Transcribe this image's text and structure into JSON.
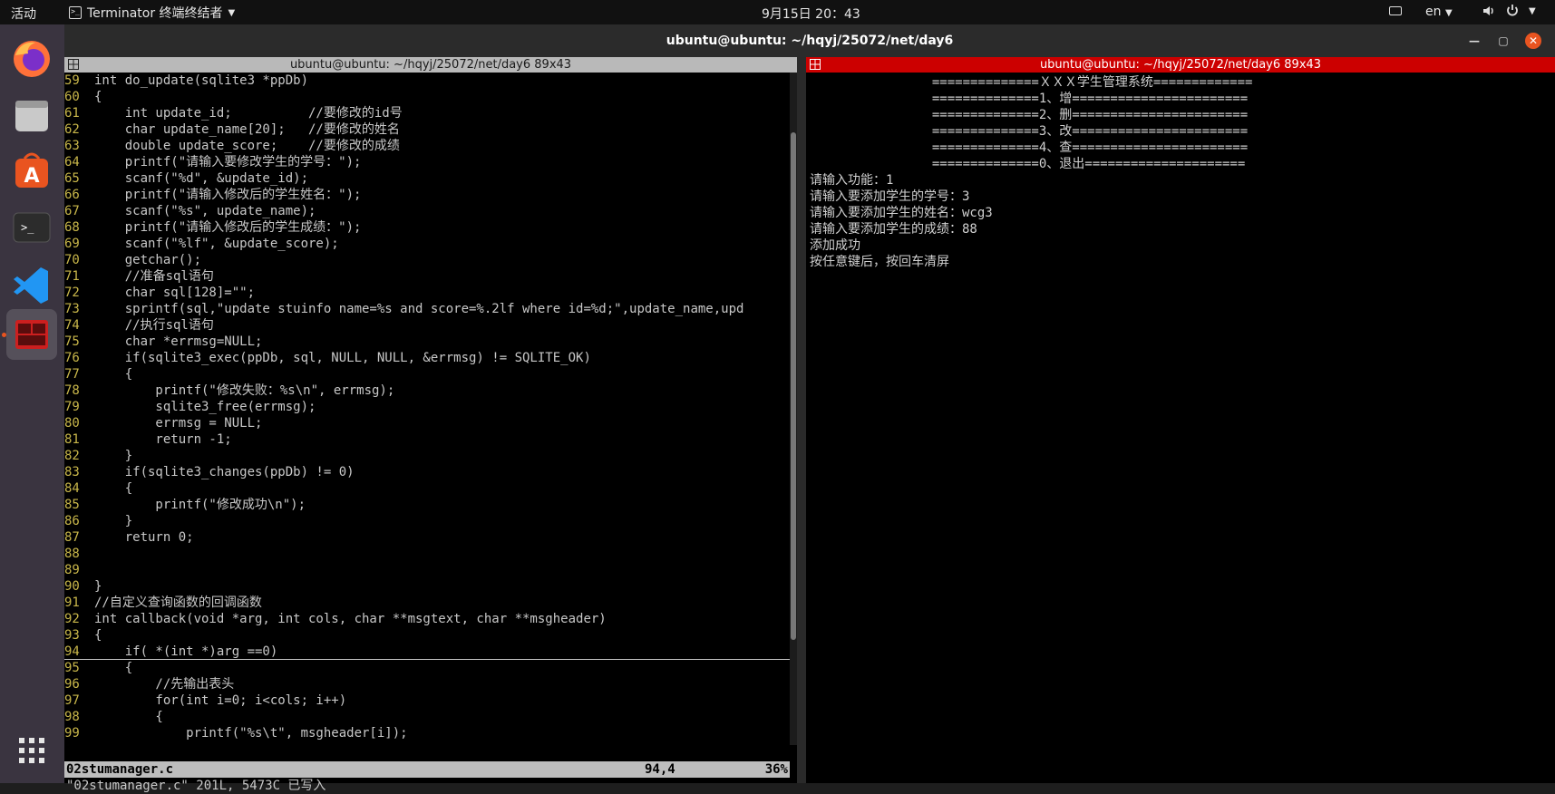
{
  "topbar": {
    "activities": "活动",
    "app_name": "Terminator 终端终结者",
    "clock": "9月15日  20：43",
    "lang": "en"
  },
  "window": {
    "title": "ubuntu@ubuntu: ~/hqyj/25072/net/day6"
  },
  "left_pane": {
    "title": "ubuntu@ubuntu: ~/hqyj/25072/net/day6 89x43",
    "lines": [
      {
        "n": "59",
        "t": "int do_update(sqlite3 *ppDb)"
      },
      {
        "n": "60",
        "t": "{"
      },
      {
        "n": "61",
        "t": "    int update_id;          //要修改的id号"
      },
      {
        "n": "62",
        "t": "    char update_name[20];   //要修改的姓名"
      },
      {
        "n": "63",
        "t": "    double update_score;    //要修改的成绩"
      },
      {
        "n": "64",
        "t": "    printf(\"请输入要修改学生的学号：\");"
      },
      {
        "n": "65",
        "t": "    scanf(\"%d\", &update_id);"
      },
      {
        "n": "66",
        "t": "    printf(\"请输入修改后的学生姓名：\");"
      },
      {
        "n": "67",
        "t": "    scanf(\"%s\", update_name);"
      },
      {
        "n": "68",
        "t": "    printf(\"请输入修改后的学生成绩：\");"
      },
      {
        "n": "69",
        "t": "    scanf(\"%lf\", &update_score);"
      },
      {
        "n": "70",
        "t": "    getchar();"
      },
      {
        "n": "71",
        "t": "    //准备sql语句"
      },
      {
        "n": "72",
        "t": "    char sql[128]=\"\";"
      },
      {
        "n": "73",
        "t": "    sprintf(sql,\"update stuinfo name=%s and score=%.2lf where id=%d;\",update_name,upd"
      },
      {
        "n": "74",
        "t": "    //执行sql语句"
      },
      {
        "n": "75",
        "t": "    char *errmsg=NULL;"
      },
      {
        "n": "76",
        "t": "    if(sqlite3_exec(ppDb, sql, NULL, NULL, &errmsg) != SQLITE_OK)"
      },
      {
        "n": "77",
        "t": "    {"
      },
      {
        "n": "78",
        "t": "        printf(\"修改失败：%s\\n\", errmsg);"
      },
      {
        "n": "79",
        "t": "        sqlite3_free(errmsg);"
      },
      {
        "n": "80",
        "t": "        errmsg = NULL;"
      },
      {
        "n": "81",
        "t": "        return -1;"
      },
      {
        "n": "82",
        "t": "    }"
      },
      {
        "n": "83",
        "t": "    if(sqlite3_changes(ppDb) != 0)"
      },
      {
        "n": "84",
        "t": "    {"
      },
      {
        "n": "85",
        "t": "        printf(\"修改成功\\n\");"
      },
      {
        "n": "86",
        "t": "    }"
      },
      {
        "n": "87",
        "t": "    return 0;"
      },
      {
        "n": "88",
        "t": ""
      },
      {
        "n": "89",
        "t": ""
      },
      {
        "n": "90",
        "t": "}"
      },
      {
        "n": "91",
        "t": "//自定义查询函数的回调函数"
      },
      {
        "n": "92",
        "t": "int callback(void *arg, int cols, char **msgtext, char **msgheader)"
      },
      {
        "n": "93",
        "t": "{"
      },
      {
        "n": "94",
        "t": "    if( *(int *)arg ==0)"
      },
      {
        "n": "95",
        "t": "    {"
      },
      {
        "n": "96",
        "t": "        //先输出表头"
      },
      {
        "n": "97",
        "t": "        for(int i=0; i<cols; i++)"
      },
      {
        "n": "98",
        "t": "        {"
      },
      {
        "n": "99",
        "t": "            printf(\"%s\\t\", msgheader[i]);"
      }
    ],
    "status": {
      "filename": "02stumanager.c",
      "position": "94,4",
      "percent": "36%"
    },
    "command_line": "\"02stumanager.c\" 201L, 5473C 已写入"
  },
  "right_pane": {
    "title": "ubuntu@ubuntu: ~/hqyj/25072/net/day6 89x43",
    "lines": [
      "                ==============ＸＸＸ学生管理系统=============",
      "                ==============1、增=======================",
      "                ==============2、删=======================",
      "                ==============3、改=======================",
      "                ==============4、查=======================",
      "                ==============0、退出=====================",
      "请输入功能：1",
      "请输入要添加学生的学号：3",
      "请输入要添加学生的姓名：wcg3",
      "请输入要添加学生的成绩：88",
      "添加成功",
      "按任意键后，按回车清屏"
    ]
  },
  "colors": {
    "accent_orange": "#e95420",
    "active_pane_red": "#cc0000",
    "line_number": "#c8b64a"
  }
}
